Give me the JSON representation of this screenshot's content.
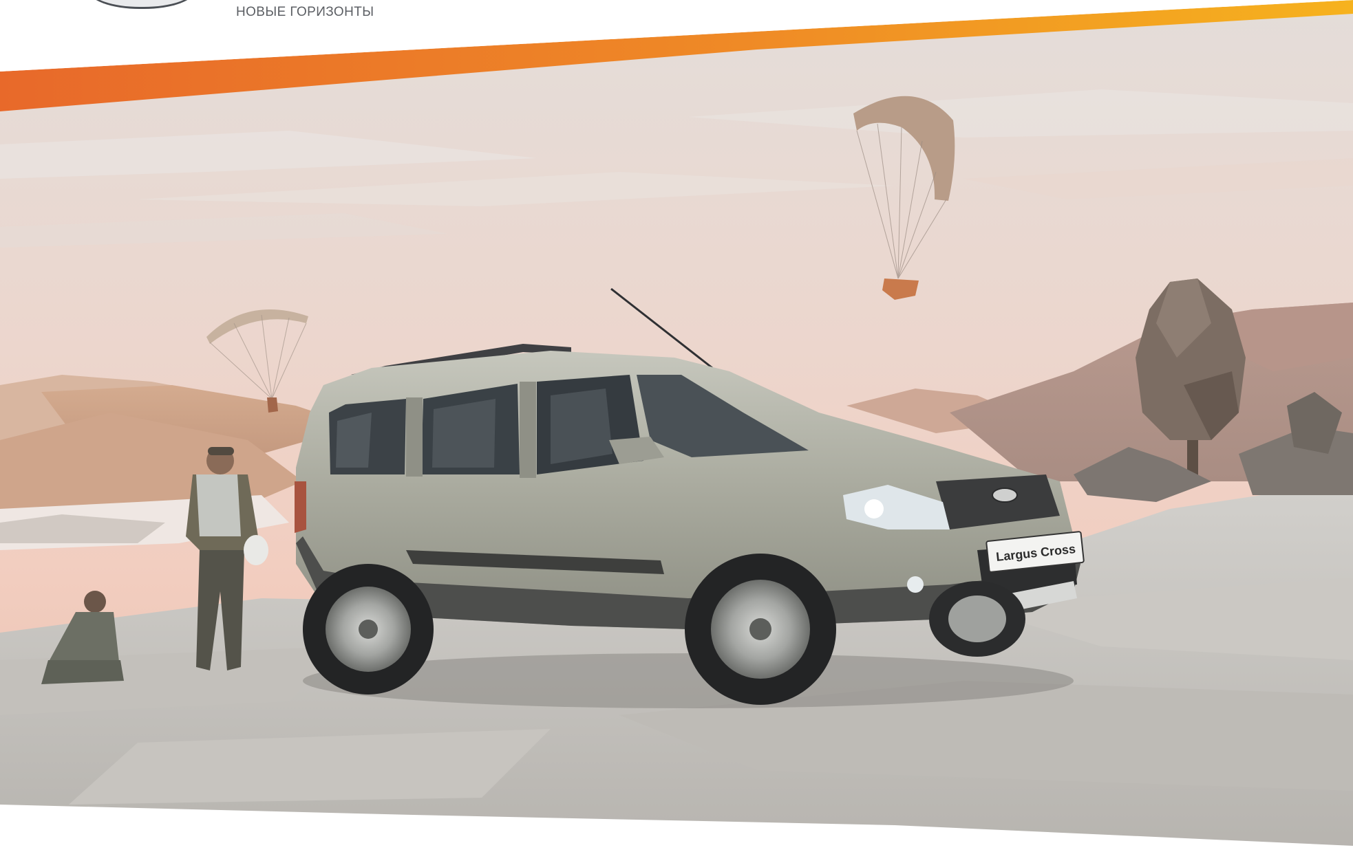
{
  "header": {
    "tagline": "НОВЫЕ ГОРИЗОНТЫ"
  },
  "car": {
    "badge_text": "Largus Cross"
  },
  "colors": {
    "accent_orange": "#e8692a",
    "accent_yellow": "#f5a623",
    "sky_top": "#e7dcd7",
    "sky_horizon": "#f0cabd",
    "ground": "#c9c7c2",
    "car_body": "#a9aa9e",
    "car_cladding": "#4b4b4b"
  }
}
